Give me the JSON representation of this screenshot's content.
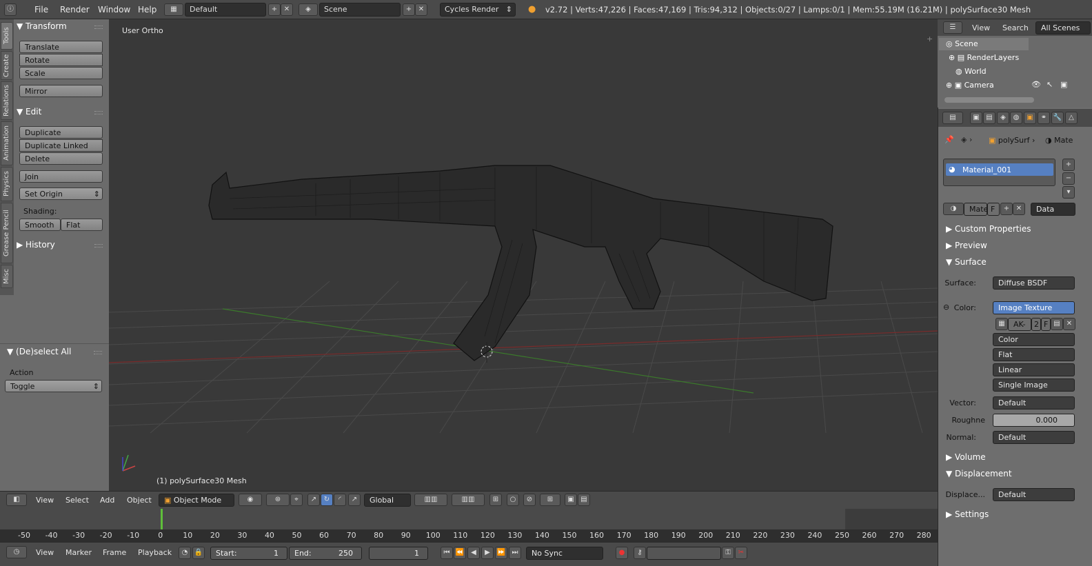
{
  "topbar": {
    "menus": [
      "File",
      "Render",
      "Window",
      "Help"
    ],
    "layout": "Default",
    "scene": "Scene",
    "engine": "Cycles Render",
    "stats": "v2.72 | Verts:47,226 | Faces:47,169 | Tris:94,312 | Objects:0/27 | Lamps:0/1 | Mem:55.19M (16.21M) | polySurface30 Mesh"
  },
  "tabs": [
    "Tools",
    "Create",
    "Relations",
    "Animation",
    "Physics",
    "Grease Pencil",
    "Misc"
  ],
  "tools": {
    "transform_title": "Transform",
    "transform": [
      "Translate",
      "Rotate",
      "Scale"
    ],
    "mirror": "Mirror",
    "edit_title": "Edit",
    "edit": [
      "Duplicate",
      "Duplicate Linked",
      "Delete"
    ],
    "join": "Join",
    "set_origin": "Set Origin",
    "shading_label": "Shading:",
    "smooth": "Smooth",
    "flat": "Flat",
    "history": "History"
  },
  "operator": {
    "title": "(De)select All",
    "action_label": "Action",
    "action_value": "Toggle"
  },
  "viewport": {
    "view_name": "User Ortho",
    "object_label": "(1) polySurface30 Mesh"
  },
  "view_header": {
    "menus": [
      "View",
      "Select",
      "Add",
      "Object"
    ],
    "mode": "Object Mode",
    "orientation": "Global"
  },
  "timeline": {
    "ticks": [
      "-50",
      "-40",
      "-30",
      "-20",
      "-10",
      "0",
      "10",
      "20",
      "30",
      "40",
      "50",
      "60",
      "70",
      "80",
      "90",
      "100",
      "110",
      "120",
      "130",
      "140",
      "150",
      "160",
      "170",
      "180",
      "190",
      "200",
      "210",
      "220",
      "230",
      "240",
      "250",
      "260",
      "270",
      "280"
    ],
    "current_frame_value": 0,
    "menus": [
      "View",
      "Marker",
      "Frame",
      "Playback"
    ],
    "start_label": "Start:",
    "start": "1",
    "end_label": "End:",
    "end": "250",
    "frame": "1",
    "sync": "No Sync"
  },
  "outliner": {
    "tabs": [
      "View",
      "Search",
      "All Scenes"
    ],
    "items": [
      "Scene",
      "RenderLayers",
      "World",
      "Camera"
    ]
  },
  "properties": {
    "breadcrumb_obj": "polySurf",
    "breadcrumb_mat": "Mate",
    "material_slot": "Material_001",
    "mat_name": "Mate",
    "mat_f": "F",
    "data_dd": "Data",
    "panels": {
      "custom": "Custom Properties",
      "preview": "Preview",
      "surface": "Surface",
      "volume": "Volume",
      "displacement": "Displacement",
      "settings": "Settings"
    },
    "surface_label": "Surface:",
    "surface_value": "Diffuse BSDF",
    "color_label": "Color:",
    "color_value": "Image Texture",
    "img_name": "AK-",
    "img_users": "2",
    "img_f": "F",
    "tex_opts": [
      "Color",
      "Flat",
      "Linear",
      "Single Image"
    ],
    "vector_label": "Vector:",
    "vector_value": "Default",
    "rough_label": "Roughne",
    "rough_value": "0.000",
    "normal_label": "Normal:",
    "normal_value": "Default",
    "disp_label": "Displace...",
    "disp_value": "Default"
  }
}
